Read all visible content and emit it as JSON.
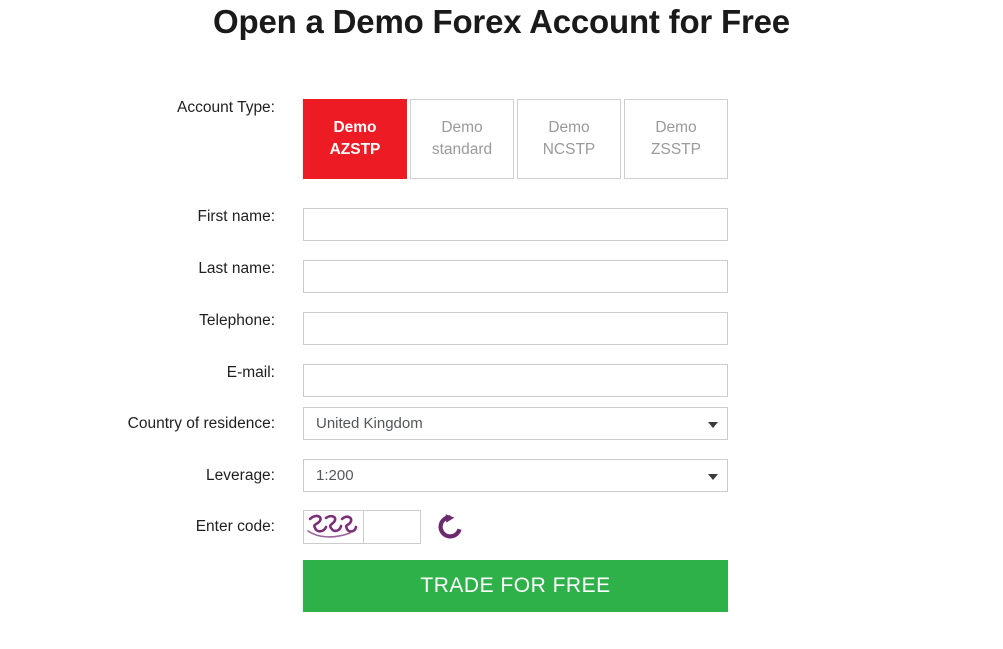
{
  "page": {
    "title": "Open a Demo Forex Account for Free"
  },
  "colors": {
    "active_tab_red": "#ed1c24",
    "submit_green": "#2fb14a",
    "captcha_purple": "#6b2a6b",
    "border_gray": "#cccccc",
    "inactive_tab_text": "#9a9a9a"
  },
  "form": {
    "account_type": {
      "label": "Account Type:",
      "tabs": [
        {
          "line1": "Demo",
          "line2": "AZSTP",
          "active": true
        },
        {
          "line1": "Demo",
          "line2": "standard",
          "active": false
        },
        {
          "line1": "Demo",
          "line2": "NCSTP",
          "active": false
        },
        {
          "line1": "Demo",
          "line2": "ZSSTP",
          "active": false
        }
      ]
    },
    "first_name": {
      "label": "First name:",
      "value": "",
      "placeholder": ""
    },
    "last_name": {
      "label": "Last name:",
      "value": "",
      "placeholder": ""
    },
    "telephone": {
      "label": "Telephone:",
      "value": "",
      "placeholder": ""
    },
    "email": {
      "label": "E-mail:",
      "value": "",
      "placeholder": ""
    },
    "country": {
      "label": "Country of residence:",
      "selected": "United Kingdom",
      "arrow_icon": "chevron-down-icon"
    },
    "leverage": {
      "label": "Leverage:",
      "selected": "1:200",
      "arrow_icon": "chevron-down-icon"
    },
    "captcha": {
      "label": "Enter code:",
      "image_text": "323",
      "input_value": "",
      "input_placeholder": "",
      "refresh_icon": "refresh-icon"
    },
    "submit": {
      "label": "TRADE FOR FREE"
    }
  }
}
